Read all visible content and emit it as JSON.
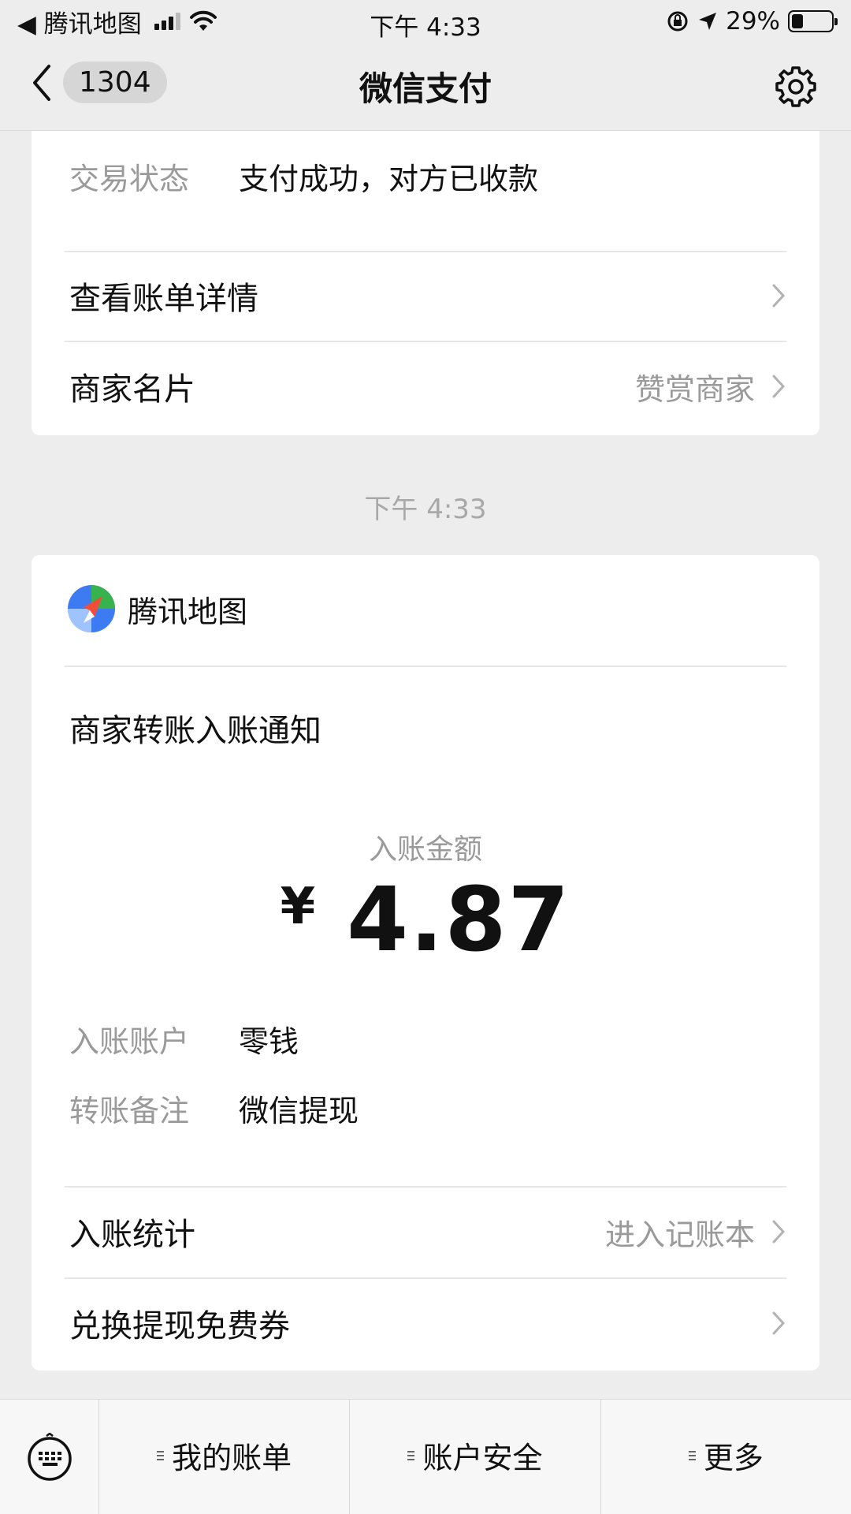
{
  "status_bar": {
    "back_app": "◀ 腾讯地图",
    "time": "下午 4:33",
    "battery": "29%",
    "battery_level": 0.29
  },
  "nav": {
    "badge": "1304",
    "title": "微信支付"
  },
  "top_card": {
    "status_label": "交易状态",
    "status_value": "支付成功，对方已收款",
    "rows": [
      {
        "label": "查看账单详情",
        "right": ""
      },
      {
        "label": "商家名片",
        "right": "赞赏商家"
      }
    ]
  },
  "timestamp": "下午 4:33",
  "notice": {
    "merchant": "腾讯地图",
    "title": "商家转账入账通知",
    "amount_label": "入账金额",
    "currency": "¥",
    "amount": "4.87",
    "details": [
      {
        "label": "入账账户",
        "value": "零钱"
      },
      {
        "label": "转账备注",
        "value": "微信提现"
      }
    ],
    "rows": [
      {
        "label": "入账统计",
        "right": "进入记账本"
      },
      {
        "label": "兑换提现免费券",
        "right": ""
      }
    ]
  },
  "bottom_menu": [
    "我的账单",
    "账户安全",
    "更多"
  ],
  "colors": {
    "background": "#ededed",
    "card": "#ffffff",
    "muted_text": "#9a9a9a"
  }
}
